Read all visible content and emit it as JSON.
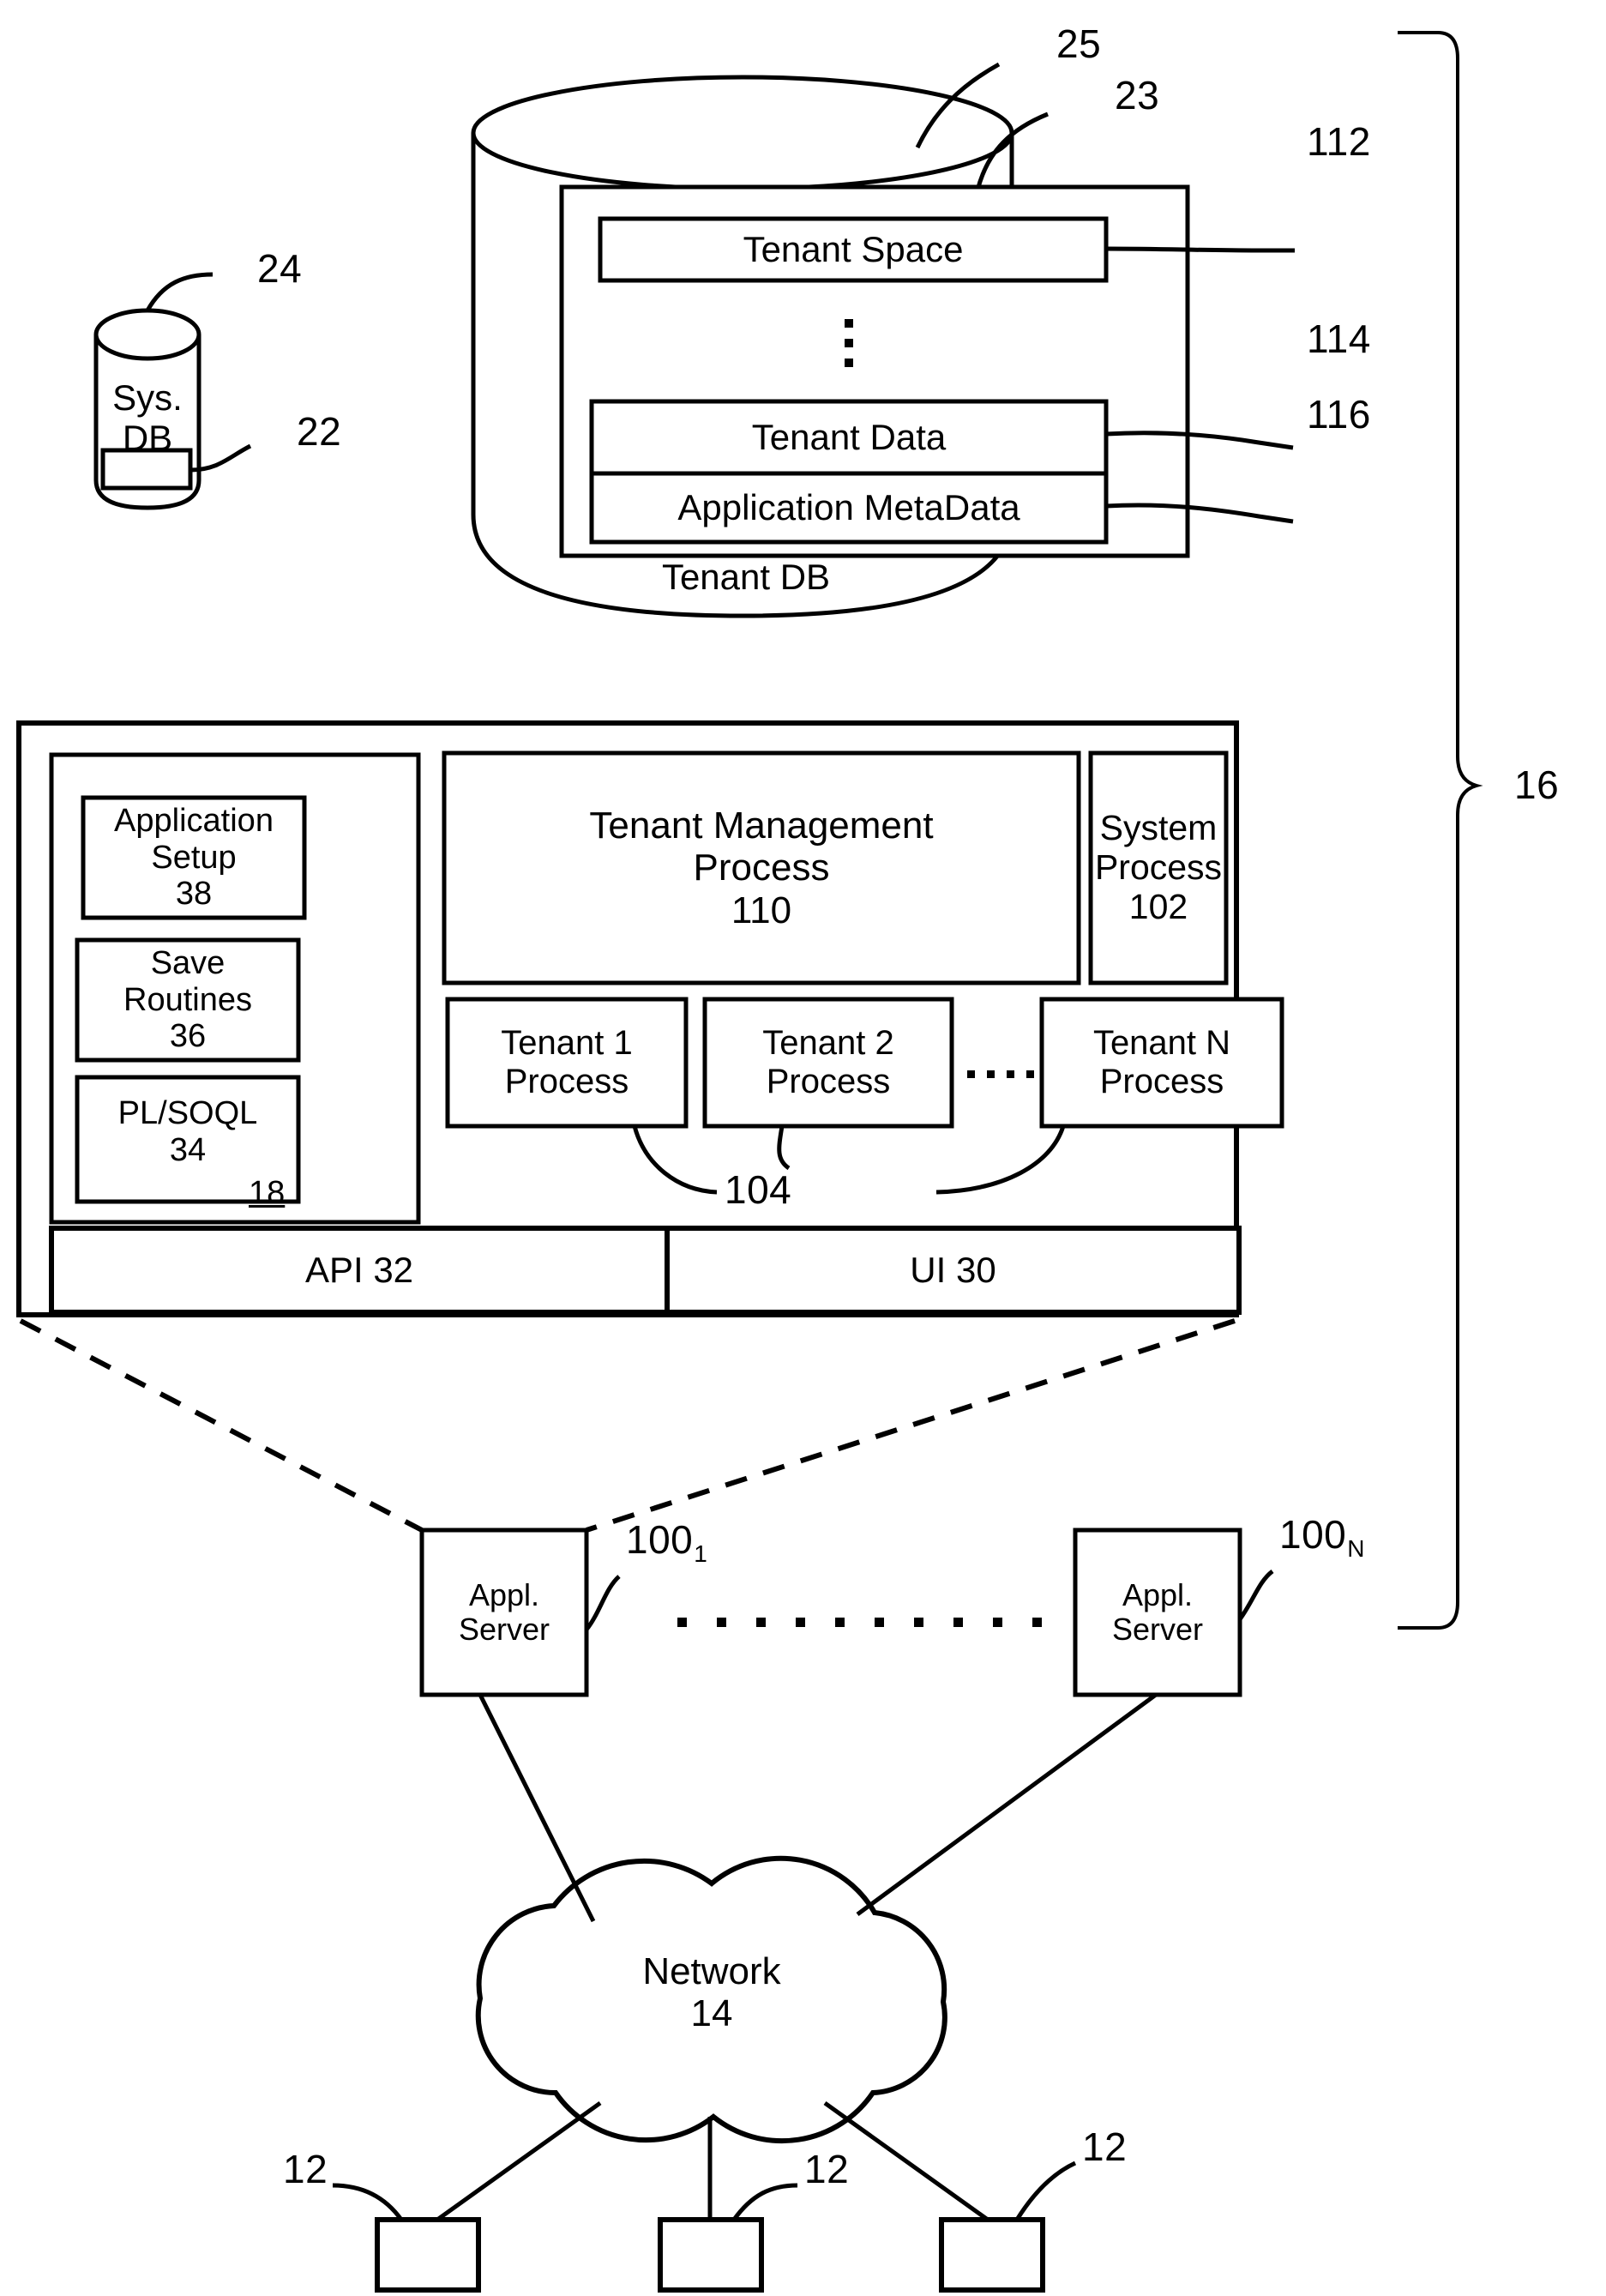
{
  "figure": {
    "type": "patent-diagram",
    "title": "Multi-tenant system architecture block diagram"
  },
  "system_db": {
    "line1": "Sys.",
    "line2": "DB",
    "ref_top": "24",
    "ref_bottom": "22"
  },
  "tenant_db": {
    "label": "Tenant DB",
    "ref_cylinder": "25",
    "ref_inner": "23",
    "blocks": [
      {
        "label": "Tenant Space",
        "ref": "112"
      },
      {
        "label": "Tenant Data",
        "ref": "114"
      },
      {
        "label": "Application MetaData",
        "ref": "116"
      }
    ],
    "vertical_ellipsis": "⋮"
  },
  "system": {
    "ref": "16",
    "process_space": {
      "ref": "18",
      "items": [
        {
          "line1": "Application",
          "line2": "Setup",
          "ref": "38"
        },
        {
          "line1": "Save",
          "line2": "Routines",
          "ref": "36"
        },
        {
          "line1": "PL/SOQL",
          "line2": "",
          "ref": "34"
        }
      ]
    },
    "tenant_management_process": {
      "line1": "Tenant Management",
      "line2": "Process",
      "ref": "110"
    },
    "system_process": {
      "line1": "System",
      "line2": "Process",
      "ref": "102"
    },
    "tenant_processes": {
      "ref": "104",
      "items": [
        {
          "line1": "Tenant 1",
          "line2": "Process"
        },
        {
          "line1": "Tenant 2",
          "line2": "Process"
        },
        {
          "line1": "Tenant N",
          "line2": "Process"
        }
      ]
    },
    "interfaces": [
      {
        "label": "API 32"
      },
      {
        "label": "UI 30"
      }
    ]
  },
  "app_servers": [
    {
      "line1": "Appl.",
      "line2": "Server",
      "ref_base": "100",
      "ref_sub": "1"
    },
    {
      "line1": "Appl.",
      "line2": "Server",
      "ref_base": "100",
      "ref_sub": "N"
    }
  ],
  "network": {
    "line1": "Network",
    "line2": "14"
  },
  "user_systems": [
    {
      "ref": "12"
    },
    {
      "ref": "12"
    },
    {
      "ref": "12"
    }
  ]
}
